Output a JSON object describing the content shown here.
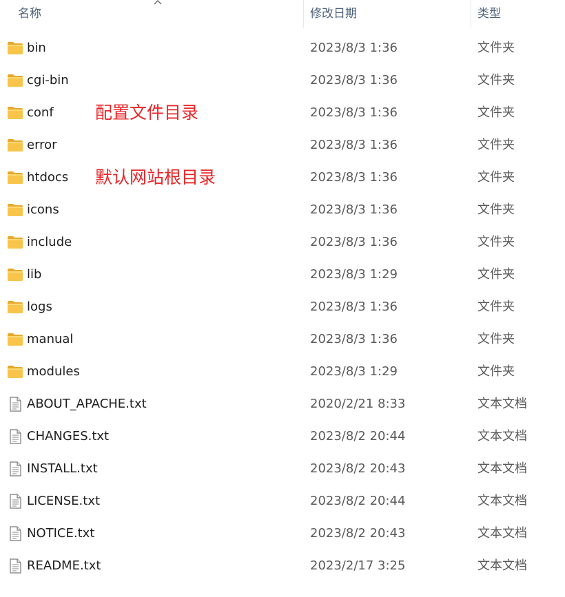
{
  "columns": {
    "name": "名称",
    "date": "修改日期",
    "type": "类型"
  },
  "sort_indicator": "ascending",
  "files": [
    {
      "name": "bin",
      "date": "2023/8/3 1:36",
      "type": "文件夹",
      "icon": "folder-icon"
    },
    {
      "name": "cgi-bin",
      "date": "2023/8/3 1:36",
      "type": "文件夹",
      "icon": "folder-icon"
    },
    {
      "name": "conf",
      "date": "2023/8/3 1:36",
      "type": "文件夹",
      "icon": "folder-icon",
      "note": "配置文件目录"
    },
    {
      "name": "error",
      "date": "2023/8/3 1:36",
      "type": "文件夹",
      "icon": "folder-icon"
    },
    {
      "name": "htdocs",
      "date": "2023/8/3 1:36",
      "type": "文件夹",
      "icon": "folder-icon",
      "note": "默认网站根目录"
    },
    {
      "name": "icons",
      "date": "2023/8/3 1:36",
      "type": "文件夹",
      "icon": "folder-icon"
    },
    {
      "name": "include",
      "date": "2023/8/3 1:36",
      "type": "文件夹",
      "icon": "folder-icon"
    },
    {
      "name": "lib",
      "date": "2023/8/3 1:29",
      "type": "文件夹",
      "icon": "folder-icon"
    },
    {
      "name": "logs",
      "date": "2023/8/3 1:36",
      "type": "文件夹",
      "icon": "folder-icon"
    },
    {
      "name": "manual",
      "date": "2023/8/3 1:36",
      "type": "文件夹",
      "icon": "folder-icon"
    },
    {
      "name": "modules",
      "date": "2023/8/3 1:29",
      "type": "文件夹",
      "icon": "folder-icon"
    },
    {
      "name": "ABOUT_APACHE.txt",
      "date": "2020/2/21 8:33",
      "type": "文本文档",
      "icon": "text-file-icon"
    },
    {
      "name": "CHANGES.txt",
      "date": "2023/8/2 20:44",
      "type": "文本文档",
      "icon": "text-file-icon"
    },
    {
      "name": "INSTALL.txt",
      "date": "2023/8/2 20:43",
      "type": "文本文档",
      "icon": "text-file-icon"
    },
    {
      "name": "LICENSE.txt",
      "date": "2023/8/2 20:44",
      "type": "文本文档",
      "icon": "text-file-icon"
    },
    {
      "name": "NOTICE.txt",
      "date": "2023/8/2 20:43",
      "type": "文本文档",
      "icon": "text-file-icon"
    },
    {
      "name": "README.txt",
      "date": "2023/2/17 3:25",
      "type": "文本文档",
      "icon": "text-file-icon"
    }
  ],
  "colors": {
    "header_text": "#4c607a",
    "annotation": "#e8262a",
    "folder": "#f8c54a"
  }
}
